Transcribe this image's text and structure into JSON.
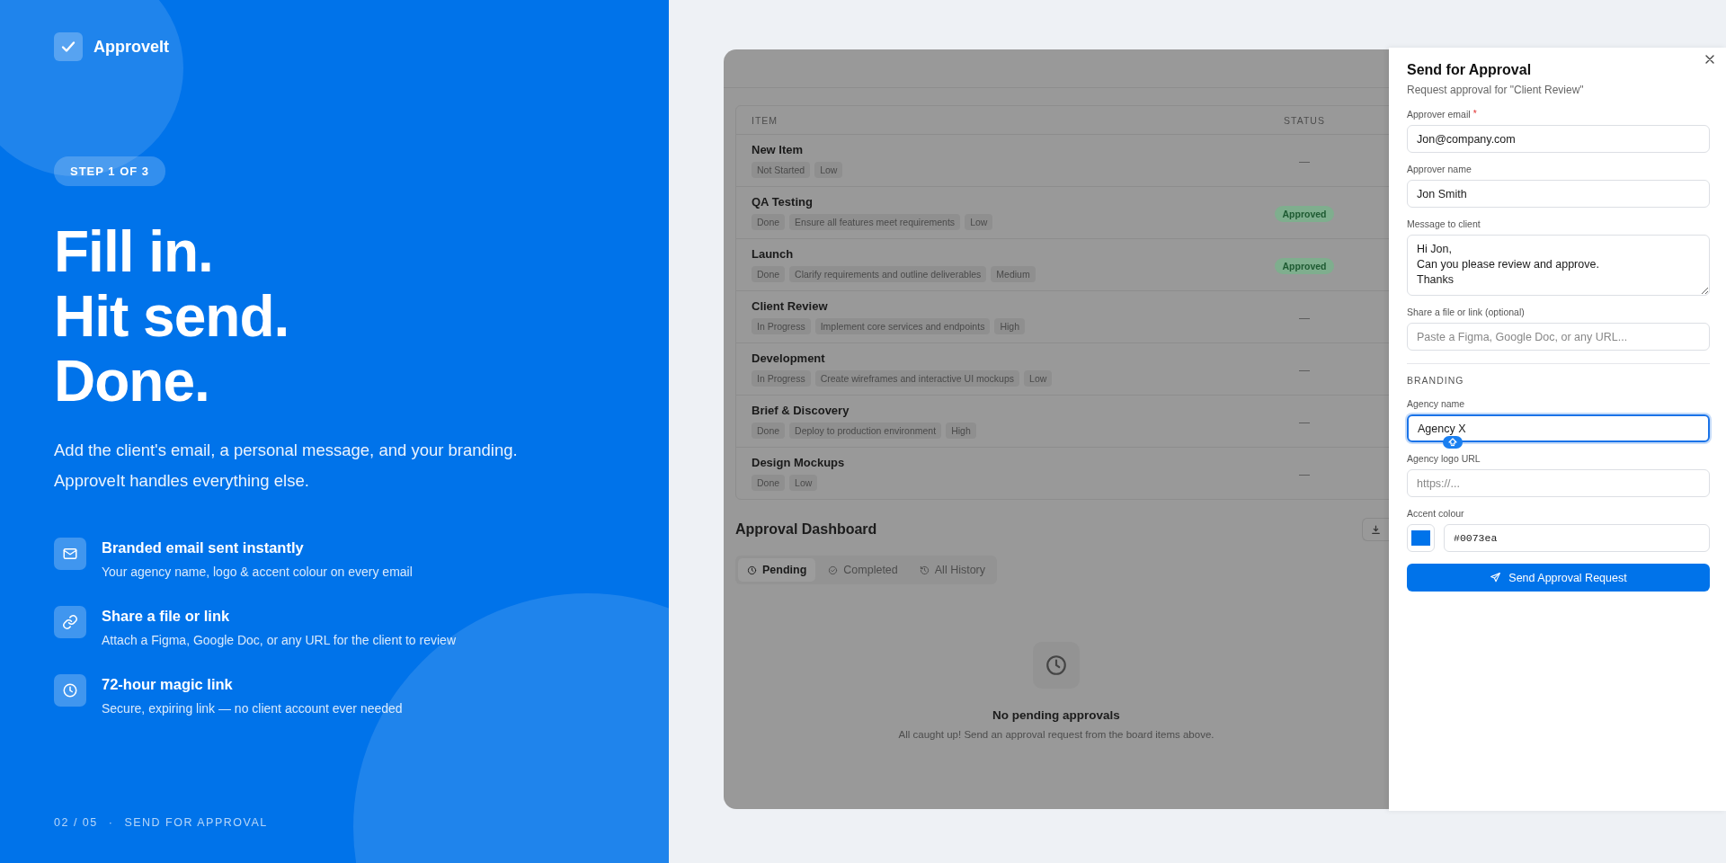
{
  "brand": {
    "name": "ApproveIt"
  },
  "step": "STEP 1 OF 3",
  "headline": [
    "Fill in.",
    "Hit send.",
    "Done."
  ],
  "intro": [
    "Add the client's email, a personal message, and your branding.",
    "ApproveIt handles everything else."
  ],
  "features": [
    {
      "kind": "mail",
      "title": "Branded email sent instantly",
      "text": "Your agency name, logo & accent colour on every email"
    },
    {
      "kind": "link",
      "title": "Share a file or link",
      "text": "Attach a Figma, Google Doc, or any URL for the client to review"
    },
    {
      "kind": "clock",
      "title": "72-hour magic link",
      "text": "Secure, expiring link — no client account ever needed"
    }
  ],
  "footer": {
    "page": "02 / 05",
    "separator": "·",
    "section": "SEND FOR APPROVAL"
  },
  "table": {
    "columns": [
      "ITEM",
      "STATUS"
    ],
    "rows": [
      {
        "title": "New Item",
        "tags": [
          "Not Started",
          "Low"
        ],
        "status": {
          "kind": "none",
          "text": "—"
        }
      },
      {
        "title": "QA Testing",
        "tags": [
          "Done",
          "Ensure all features meet requirements",
          "Low"
        ],
        "status": {
          "kind": "approved",
          "text": "Approved"
        }
      },
      {
        "title": "Launch",
        "tags": [
          "Done",
          "Clarify requirements and outline deliverables",
          "Medium"
        ],
        "status": {
          "kind": "approved",
          "text": "Approved"
        }
      },
      {
        "title": "Client Review",
        "tags": [
          "In Progress",
          "Implement core services and endpoints",
          "High"
        ],
        "status": {
          "kind": "none",
          "text": "—"
        }
      },
      {
        "title": "Development",
        "tags": [
          "In Progress",
          "Create wireframes and interactive UI mockups",
          "Low"
        ],
        "status": {
          "kind": "none",
          "text": "—"
        }
      },
      {
        "title": "Brief & Discovery",
        "tags": [
          "Done",
          "Deploy to production environment",
          "High"
        ],
        "status": {
          "kind": "none",
          "text": "—"
        }
      },
      {
        "title": "Design Mockups",
        "tags": [
          "Done",
          "Low"
        ],
        "status": {
          "kind": "none",
          "text": "—"
        }
      }
    ]
  },
  "dashboard": {
    "title": "Approval Dashboard",
    "tabs": [
      {
        "label": "Pending",
        "selected": true
      },
      {
        "label": "Completed",
        "selected": false
      },
      {
        "label": "All History",
        "selected": false
      }
    ],
    "empty": {
      "title": "No pending approvals",
      "text": "All caught up! Send an approval request from the board items above."
    }
  },
  "drawer": {
    "title": "Send for Approval",
    "subtitle": "Request approval for \"Client Review\"",
    "fields": [
      {
        "kind": "input",
        "label": "Approver email",
        "required_mark": "*",
        "value": "Jon@company.com"
      },
      {
        "kind": "input",
        "label": "Approver name",
        "value": "Jon Smith"
      },
      {
        "kind": "textarea",
        "label": "Message to client",
        "value": "Hi Jon,\nCan you please review and approve.\nThanks"
      },
      {
        "kind": "input",
        "label": "Share a file or link (optional)",
        "placeholder": "Paste a Figma, Google Doc, or any URL..."
      }
    ],
    "section": "BRANDING",
    "branding": [
      {
        "kind": "input",
        "label": "Agency name",
        "value": "Agency X",
        "focused": true
      },
      {
        "kind": "input",
        "label": "Agency logo URL",
        "placeholder": "https://...",
        "focused": false
      },
      {
        "kind": "color",
        "label": "Accent colour",
        "value": "#0073ea",
        "color": "#0073ea",
        "focused": false
      }
    ],
    "button": "Send Approval Request"
  }
}
